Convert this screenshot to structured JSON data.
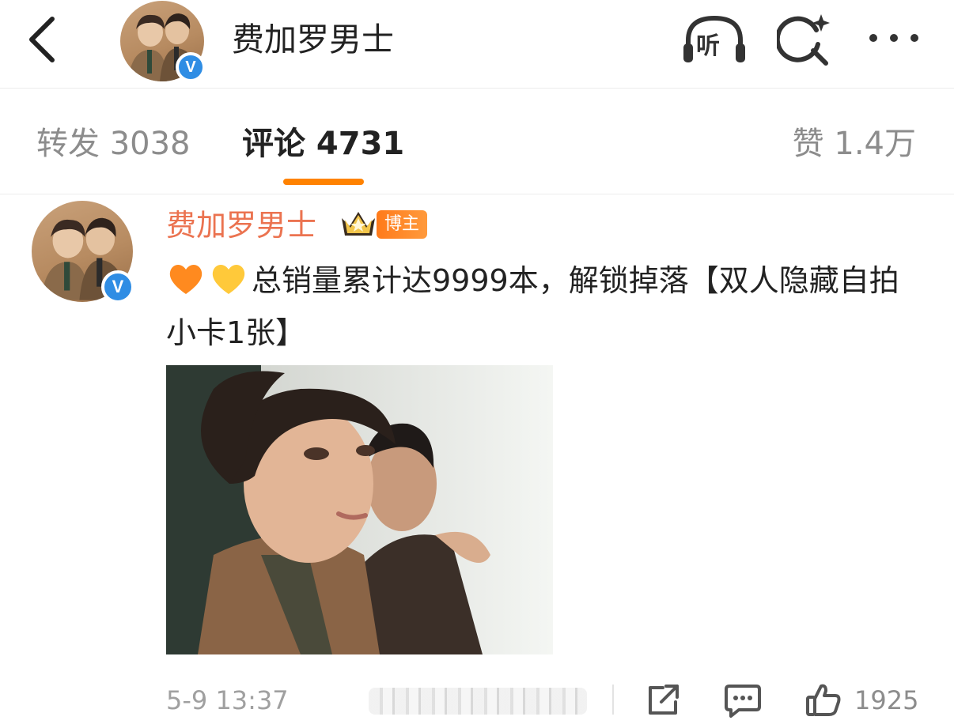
{
  "header": {
    "title": "费加罗男士",
    "listen_label": "听",
    "verified_mark": "V"
  },
  "tabs": {
    "repost": "转发 3038",
    "comment": "评论 4731",
    "like": "赞 1.4万",
    "active": "comment",
    "accent_color": "#ff8200"
  },
  "comment": {
    "author": "费加罗男士",
    "author_color": "#eb7350",
    "badge": "博主",
    "verified_mark": "V",
    "emoji": [
      "orange-heart",
      "yellow-heart"
    ],
    "text": "总销量累计达9999本，解锁掉落【双人隐藏自拍小卡1张】",
    "timestamp": "5-9 13:37",
    "like_count": "1925"
  },
  "colors": {
    "verified_blue": "#2f8de4",
    "badge_orange": "#ff7a1a"
  }
}
